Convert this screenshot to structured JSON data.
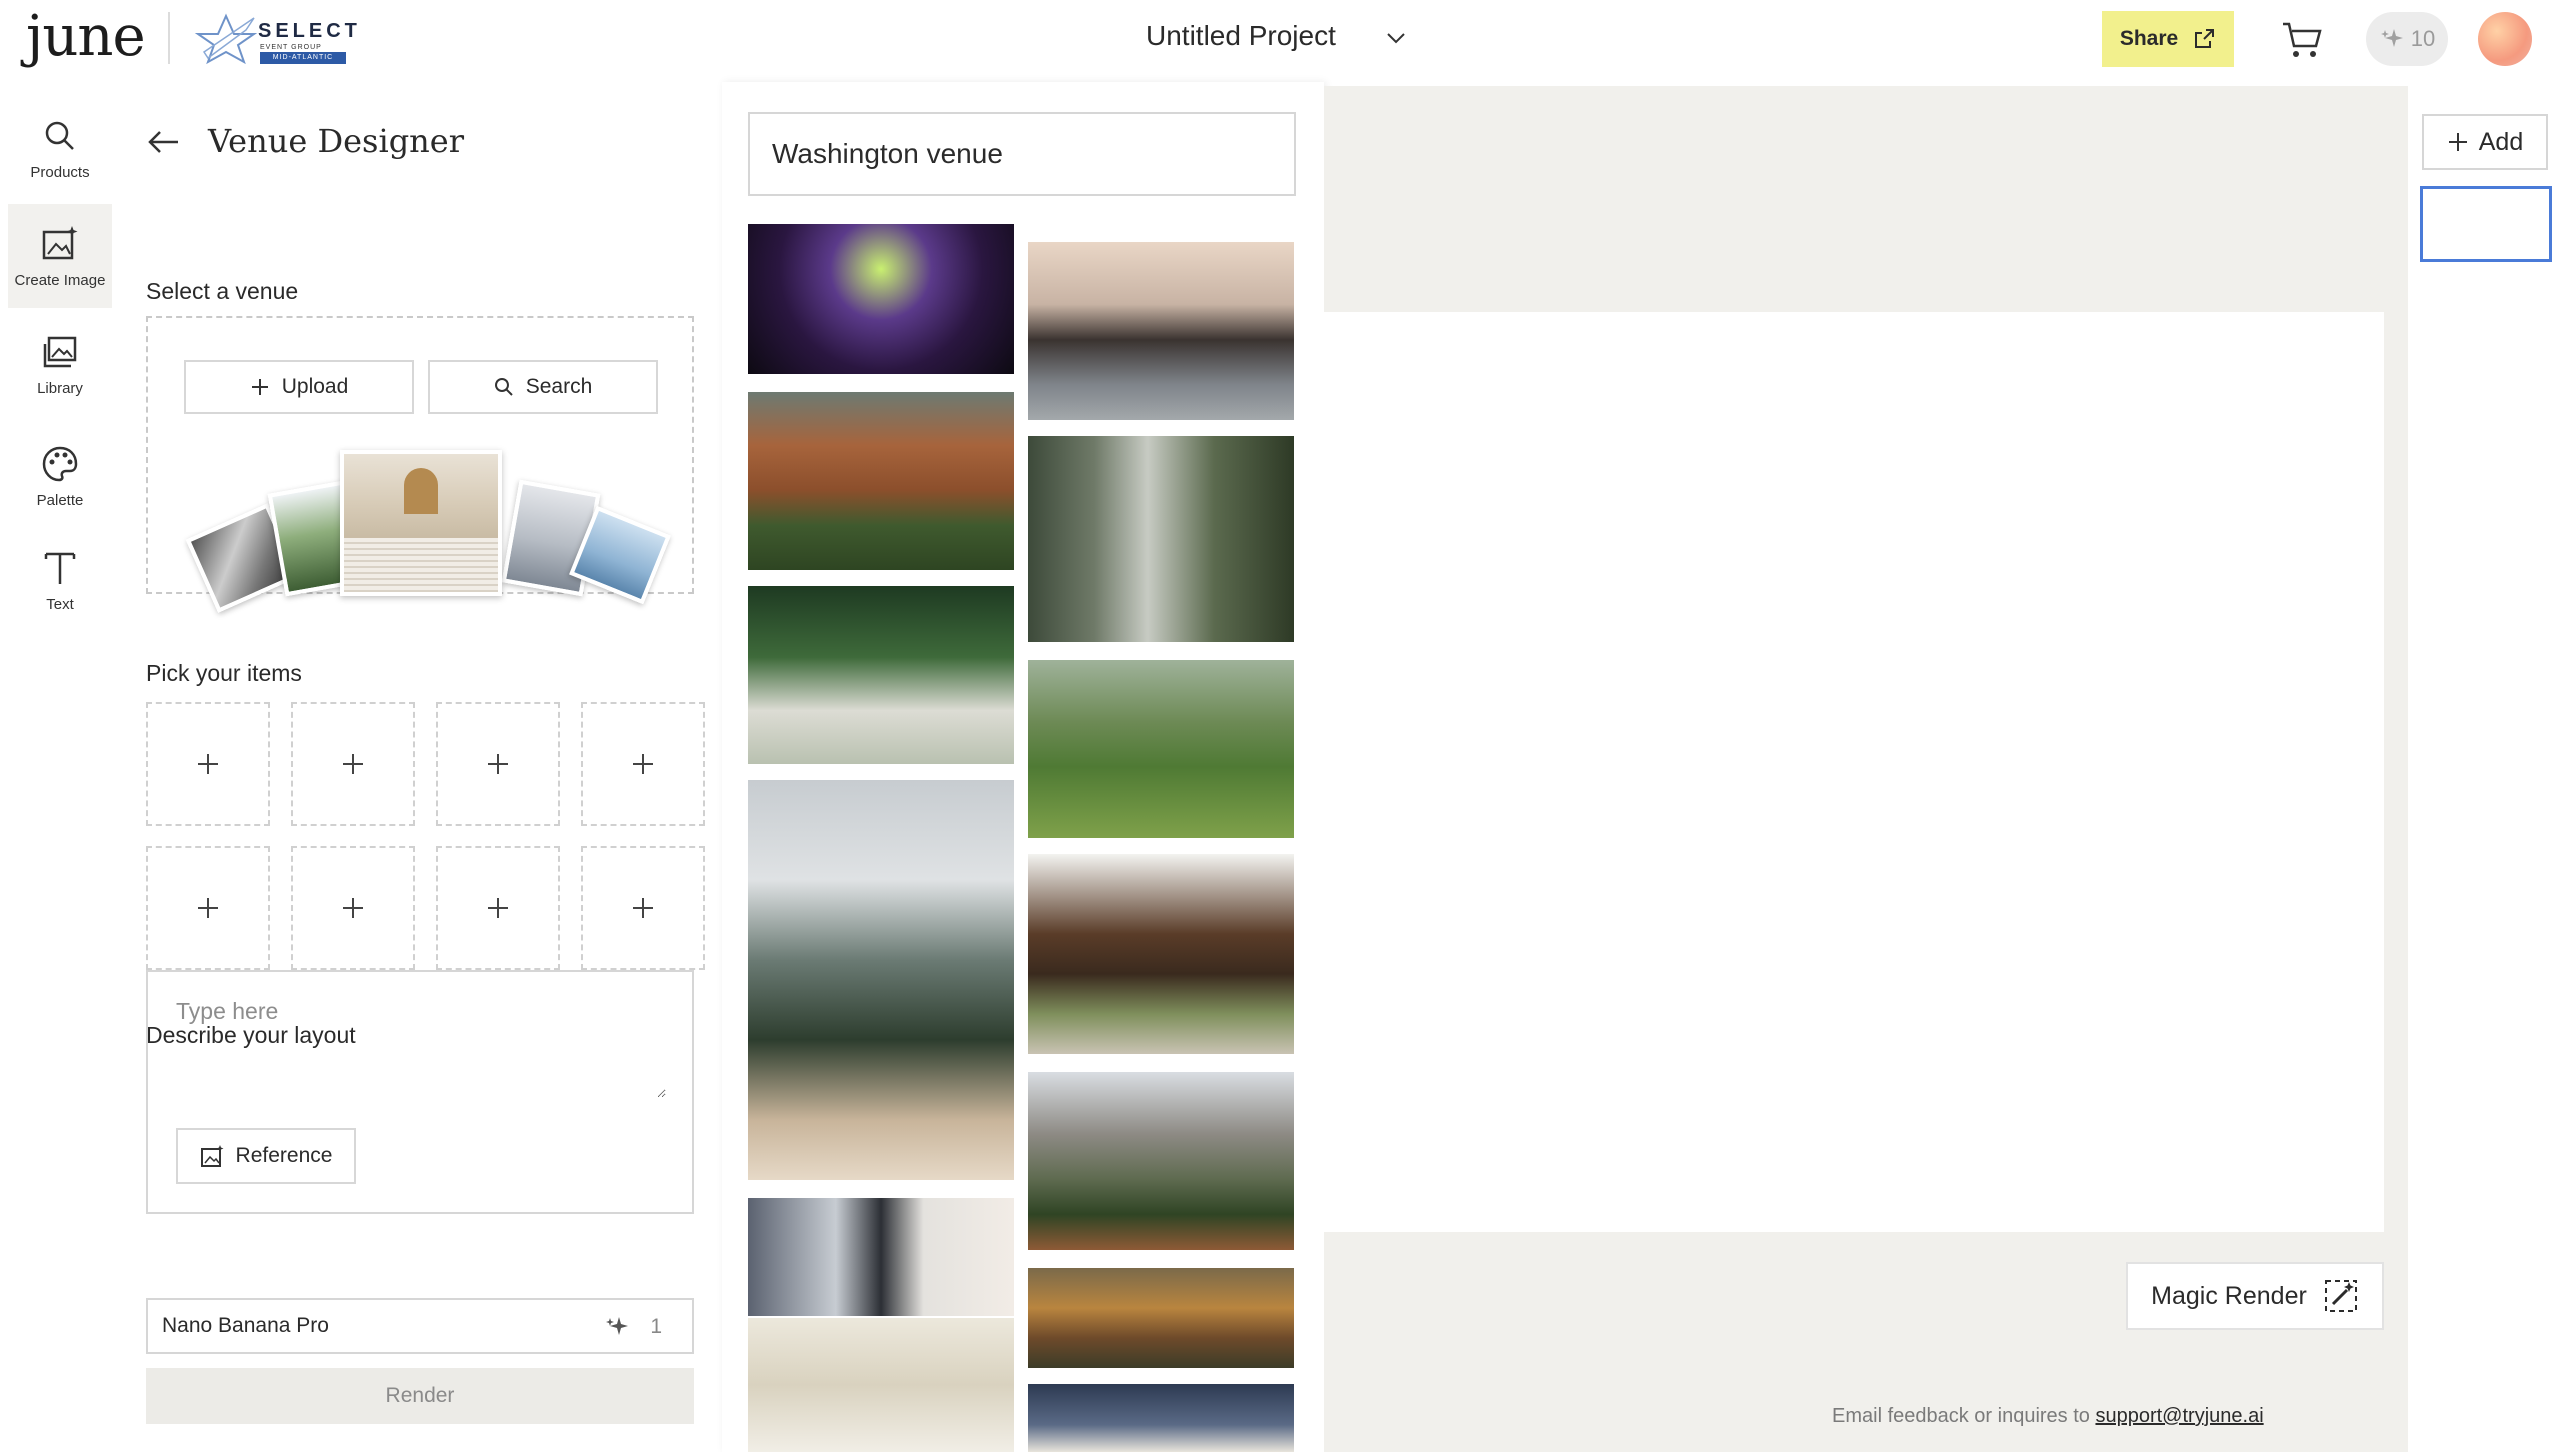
{
  "header": {
    "brand": "june",
    "partner_word": "SELECT",
    "partner_sub": "EVENT GROUP",
    "partner_badge": "MID-ATLANTIC",
    "project_title": "Untitled Project",
    "share_label": "Share",
    "credits": "10"
  },
  "rail": {
    "items": [
      {
        "label": "Products",
        "icon": "search-icon"
      },
      {
        "label": "Create Image",
        "icon": "create-image-icon"
      },
      {
        "label": "Library",
        "icon": "library-icon"
      },
      {
        "label": "Palette",
        "icon": "palette-icon"
      },
      {
        "label": "Text",
        "icon": "text-icon"
      }
    ]
  },
  "designer": {
    "title": "Venue Designer",
    "select_venue_label": "Select a venue",
    "upload_label": "Upload",
    "search_label": "Search",
    "pick_items_label": "Pick your items",
    "describe_label": "Describe your layout",
    "describe_placeholder": "Type here",
    "reference_label": "Reference",
    "model_name": "Nano Banana Pro",
    "model_cost": "1",
    "render_label": "Render"
  },
  "results": {
    "query": "Washington venue"
  },
  "canvas": {
    "magic_render_label": "Magic Render",
    "feedback_text": "Email feedback or inquires to ",
    "feedback_email": "support@tryjune.ai"
  },
  "pages": {
    "add_label": "Add"
  },
  "colors": {
    "share_bg": "#f2f08d",
    "canvas_bg": "#f1f0ec",
    "active_page_border": "#4a7bd8"
  }
}
